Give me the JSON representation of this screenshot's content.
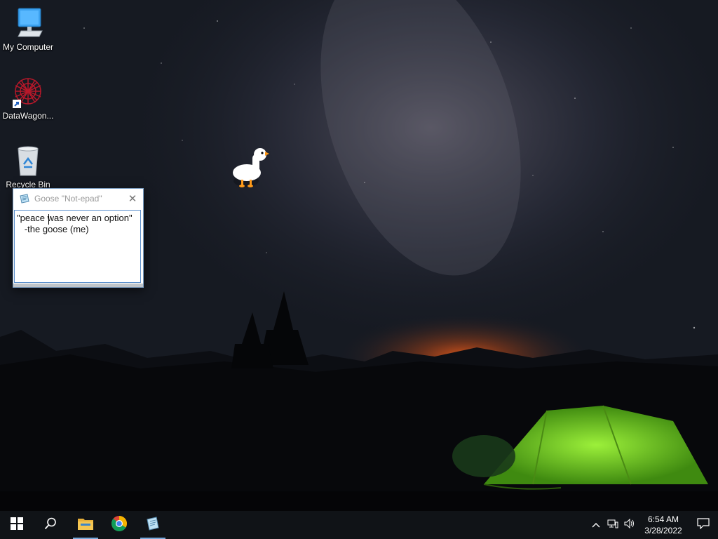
{
  "desktop": {
    "icons": [
      {
        "label": "My Computer",
        "icon": "my-computer-icon"
      },
      {
        "label": "DataWagon...",
        "icon": "datawagon-shortcut-icon"
      },
      {
        "label": "Recycle Bin",
        "icon": "recycle-bin-icon"
      }
    ],
    "wallpaper": "night sky with milky way, mountains and green tent",
    "goose": "desktop-goose-sprite"
  },
  "notepad": {
    "title": "Goose \"Not-epad\"",
    "close_glyph": "✕",
    "lines": [
      "\"peace was never an option\"",
      "   -the goose (me)"
    ]
  },
  "taskbar": {
    "apps": [
      {
        "name": "start-button"
      },
      {
        "name": "search-button"
      },
      {
        "name": "file-explorer-button",
        "active": true
      },
      {
        "name": "chrome-button",
        "active": false
      },
      {
        "name": "goose-notepad-button",
        "active": true
      }
    ],
    "clock": {
      "time": "6:54 AM",
      "date": "3/28/2022"
    }
  },
  "colors": {
    "taskbar_bg": "#101317",
    "active_indicator": "#78a9dc",
    "tent_green": "#7ee02a"
  }
}
